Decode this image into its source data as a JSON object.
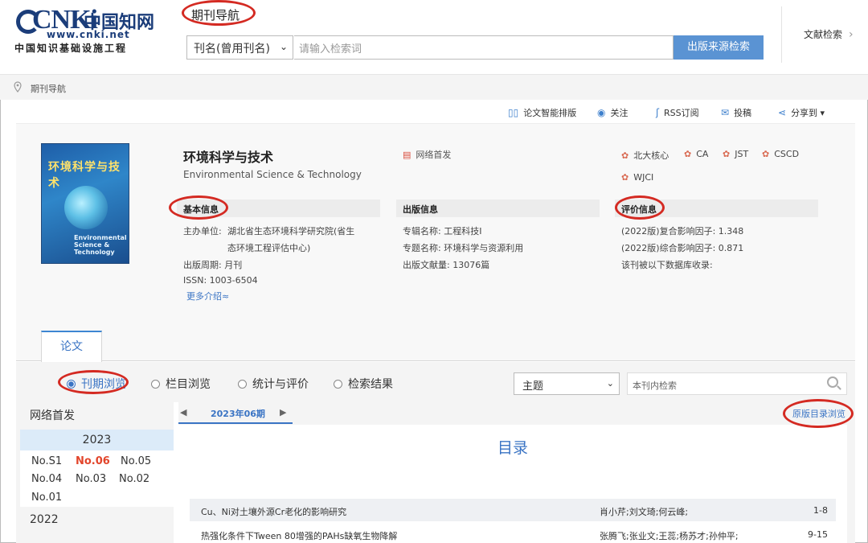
{
  "header": {
    "logo_big": "CNKi",
    "logo_cn": "中国知网",
    "logo_url": "www.cnki.net",
    "logo_sub": "中国知识基础设施工程",
    "nav_title": "期刊导航",
    "search_field_selected": "刊名(曾用刊名)",
    "search_placeholder": "请输入检索词",
    "search_button": "出版来源检索",
    "lit_search": "文献检索"
  },
  "breadcrumb": {
    "label": "期刊导航"
  },
  "toolbar": {
    "items": [
      {
        "label": "论文智能排版",
        "icon": "layout-icon"
      },
      {
        "label": "关注",
        "icon": "eye-icon"
      },
      {
        "label": "RSS订阅",
        "icon": "rss-icon"
      },
      {
        "label": "投稿",
        "icon": "mail-icon"
      },
      {
        "label": "分享到 ▾",
        "icon": "share-icon"
      }
    ]
  },
  "journal": {
    "title": "环境科学与技术",
    "title_en": "Environmental Science & Technology",
    "network_first": "网络首发",
    "cover_title": "环境科学与技术",
    "cover_en": "Environmental Science & Technology",
    "badges": [
      "北大核心",
      "CA",
      "JST",
      "CSCD",
      "WJCI"
    ],
    "basic_info": {
      "heading": "基本信息",
      "sponsor_label": "主办单位:",
      "sponsor_line1": "湖北省生态环境科学研究院(省生",
      "sponsor_line2": "态环境工程评估中心)",
      "period": "出版周期:  月刊",
      "issn": "ISSN:  1003-6504",
      "more": "更多介绍≈"
    },
    "pub_info": {
      "heading": "出版信息",
      "series": "专辑名称:   工程科技I",
      "topic": "专题名称:   环境科学与资源利用",
      "count": "出版文献量:  13076篇"
    },
    "eval_info": {
      "heading": "评价信息",
      "compound_if": "(2022版)复合影响因子:  1.348",
      "comprehensive_if": "(2022版)综合影响因子:  0.871",
      "db_included": "该刊被以下数据库收录:"
    }
  },
  "tabs": {
    "active": "论文"
  },
  "browse": {
    "options": [
      "刊期浏览",
      "栏目浏览",
      "统计与评价",
      "检索结果"
    ],
    "selected": "刊期浏览",
    "topic_select": "主题",
    "inner_search_placeholder": "本刊内检索"
  },
  "year_nav": {
    "title": "网络首发",
    "year": "2023",
    "issues": [
      "No.S1",
      "No.06",
      "No.05",
      "No.04",
      "No.03",
      "No.02",
      "No.01"
    ],
    "active_issue": "No.06",
    "next_year": "2022"
  },
  "issue_view": {
    "current": "2023年06期",
    "prev": "◀",
    "next": "▶",
    "orig_link": "原版目录浏览",
    "toc_title": "目录",
    "articles": [
      {
        "title": "Cu、Ni对土壤外源Cr老化的影响研究",
        "authors": "肖小芹;刘文琦;何云峰;",
        "pages": "1-8"
      },
      {
        "title": "热强化条件下Tween 80增强的PAHs缺氧生物降解",
        "authors": "张腾飞;张业文;王蕊;杨苏才;孙仲平;",
        "pages": "9-15"
      }
    ]
  },
  "colors": {
    "accent": "#3a74c4",
    "annotation": "#d42a22",
    "active_issue": "#e2452b"
  }
}
